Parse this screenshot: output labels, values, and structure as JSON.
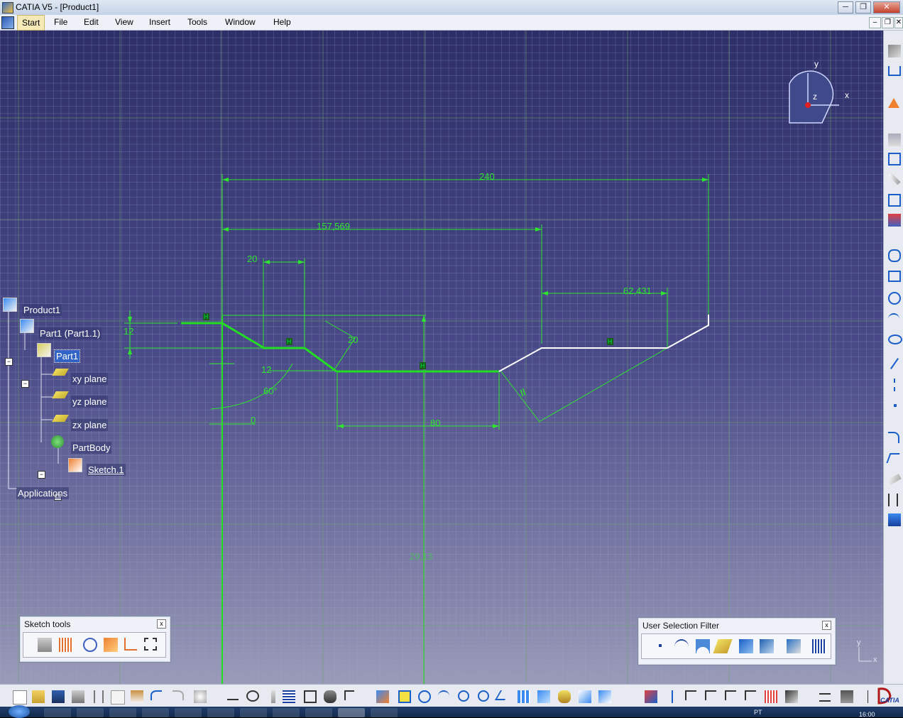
{
  "window": {
    "title": "CATIA V5 - [Product1]",
    "controls": {
      "minimize": "─",
      "restore": "❐",
      "close": "✕"
    }
  },
  "menu": {
    "items": [
      "Start",
      "File",
      "Edit",
      "View",
      "Insert",
      "Tools",
      "Window",
      "Help"
    ],
    "mdi_controls": {
      "minimize": "–",
      "restore": "❐",
      "close": "✕"
    }
  },
  "tree": {
    "product": "Product1",
    "part_instance": "Part1 (Part1.1)",
    "part": "Part1",
    "planes": [
      "xy plane",
      "yz plane",
      "zx plane"
    ],
    "body": "PartBody",
    "sketch": "Sketch.1",
    "applications": "Applications"
  },
  "compass": {
    "x": "x",
    "y": "y",
    "z": "z"
  },
  "corner_axes": {
    "x": "x",
    "y": "y"
  },
  "dimensions": {
    "d240": "240",
    "d157": "157,569",
    "d20_top": "20",
    "d62": "62,431",
    "d12_left": "12",
    "d20_angle": "20",
    "d12_mid": "12",
    "d60": "60°",
    "d0": "0",
    "d80": "80",
    "d2913": "29,13"
  },
  "constraint_marks": {
    "horizontal": "H",
    "parallel": "//"
  },
  "sketch_tools": {
    "title": "Sketch tools",
    "close": "x"
  },
  "user_selection_filter": {
    "title": "User Selection Filter",
    "close": "x"
  },
  "colors": {
    "background_top": "#2e2e68",
    "background_bottom": "#9a9ab8",
    "geometry_constrained": "#22dd22",
    "geometry_unconstrained": "#ffffff",
    "dimension": "#2ee62e",
    "selection": "#3264c8"
  },
  "taskbar": {
    "language": "PT",
    "clock": "16:00"
  },
  "catia_logo": "CATIA"
}
